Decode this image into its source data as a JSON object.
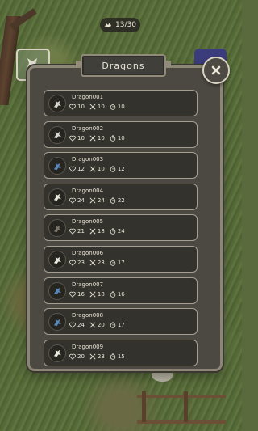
{
  "counter": {
    "icon": "dragon-token-icon",
    "text": "13/30"
  },
  "panel": {
    "title": "Dragons"
  },
  "close": {
    "icon": "close-icon"
  },
  "dragons": [
    {
      "name": "Dragon001",
      "health": "10",
      "attack": "10",
      "speed": "10",
      "avatar_color": "#d8d5cc"
    },
    {
      "name": "Dragon002",
      "health": "10",
      "attack": "10",
      "speed": "10",
      "avatar_color": "#d8d5cc"
    },
    {
      "name": "Dragon003",
      "health": "12",
      "attack": "10",
      "speed": "12",
      "avatar_color": "#5b86b8"
    },
    {
      "name": "Dragon004",
      "health": "24",
      "attack": "24",
      "speed": "22",
      "avatar_color": "#e9e6dd"
    },
    {
      "name": "Dragon005",
      "health": "21",
      "attack": "18",
      "speed": "24",
      "avatar_color": "#7b756a"
    },
    {
      "name": "Dragon006",
      "health": "23",
      "attack": "23",
      "speed": "17",
      "avatar_color": "#e9e6dd"
    },
    {
      "name": "Dragon007",
      "health": "16",
      "attack": "18",
      "speed": "16",
      "avatar_color": "#5b86b8"
    },
    {
      "name": "Dragon008",
      "health": "24",
      "attack": "20",
      "speed": "17",
      "avatar_color": "#5b86b8"
    },
    {
      "name": "Dragon009",
      "health": "20",
      "attack": "23",
      "speed": "15",
      "avatar_color": "#e9e6dd"
    }
  ],
  "stat_icons": {
    "health": "heart-icon",
    "attack": "swords-icon",
    "speed": "stopwatch-icon"
  }
}
